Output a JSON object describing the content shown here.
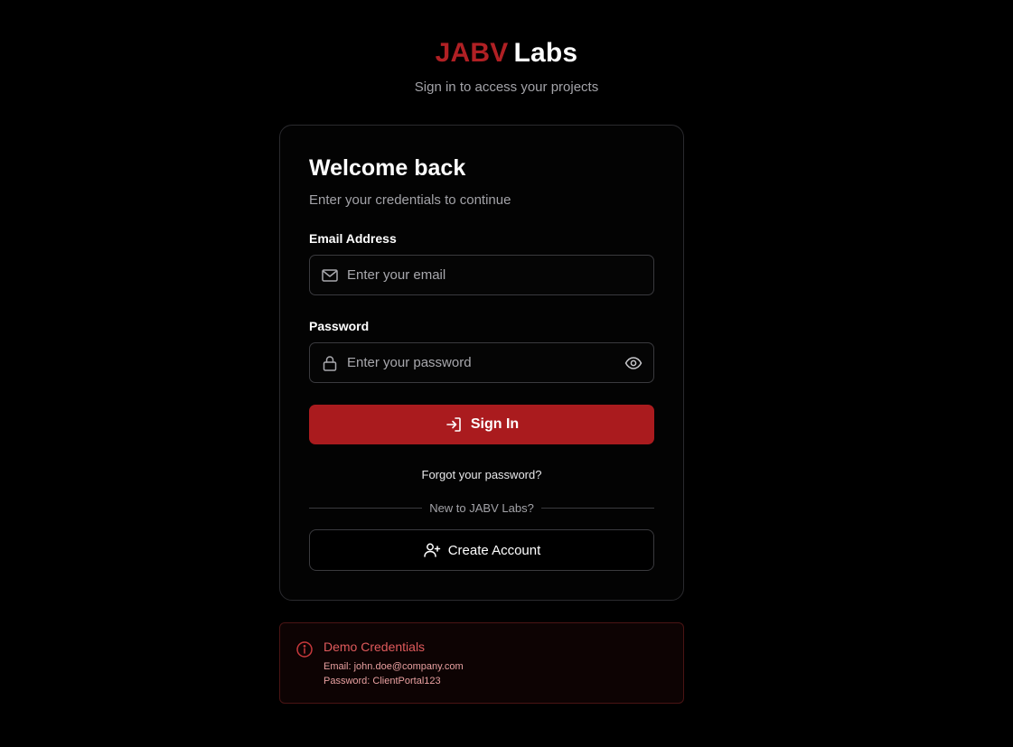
{
  "brand": {
    "accent": "JABV",
    "rest": "Labs",
    "tagline": "Sign in to access your projects"
  },
  "card": {
    "title": "Welcome back",
    "subtitle": "Enter your credentials to continue",
    "email": {
      "label": "Email Address",
      "placeholder": "Enter your email",
      "value": "",
      "icon": "mail-icon"
    },
    "password": {
      "label": "Password",
      "placeholder": "Enter your password",
      "value": "",
      "icon": "lock-icon",
      "toggle_icon": "eye-icon"
    },
    "signin_label": "Sign In",
    "forgot_label": "Forgot your password?",
    "divider_text": "New to JABV Labs?",
    "create_label": "Create Account"
  },
  "demo": {
    "title": "Demo Credentials",
    "email_line": "Email: john.doe@company.com",
    "password_line": "Password: ClientPortal123"
  },
  "colors": {
    "background": "#000000",
    "accent": "#aa1b1e",
    "brand_red": "#b02024",
    "demo_text": "#e05a5c",
    "muted_text": "#a3a3a8",
    "border": "#3a3a3e"
  }
}
